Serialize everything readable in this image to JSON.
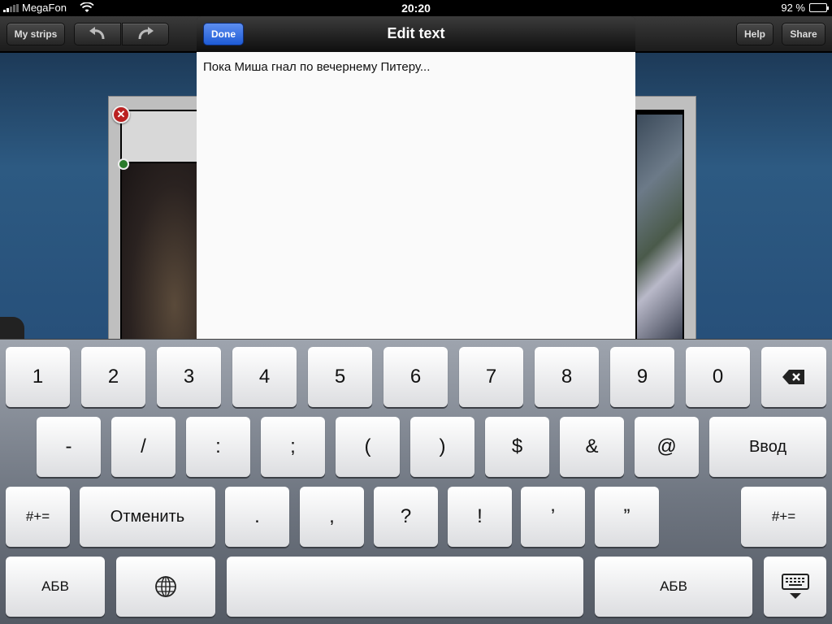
{
  "status_bar": {
    "carrier": "MegaFon",
    "time": "20:20",
    "battery": "92 %",
    "battery_level": 0.92
  },
  "toolbar": {
    "my_strips": "My strips",
    "help": "Help",
    "share": "Share"
  },
  "popover": {
    "title": "Edit text",
    "done": "Done",
    "text": "Пока Миша гнал по вечернему Питеру..."
  },
  "keyboard": {
    "row1": [
      "1",
      "2",
      "3",
      "4",
      "5",
      "6",
      "7",
      "8",
      "9",
      "0"
    ],
    "row2": [
      "-",
      "/",
      ":",
      ";",
      "(",
      ")",
      "$",
      "&",
      "@"
    ],
    "return": "Ввод",
    "row3": [
      ".",
      ",",
      "?",
      "!",
      "’",
      "”"
    ],
    "symbols_left": "#+=",
    "undo": "Отменить",
    "symbols_right": "#+=",
    "abc_left": "АБВ",
    "abc_right": "АБВ"
  },
  "icons": {
    "wifi": "wifi-icon",
    "undo": "undo-arrow-icon",
    "redo": "redo-arrow-icon",
    "delete": "close-icon",
    "globe": "globe-icon",
    "backspace": "backspace-icon",
    "hide_keyboard": "keyboard-hide-icon"
  },
  "colors": {
    "done_button": "#2a66dd",
    "canvas": "#2d5a82"
  }
}
